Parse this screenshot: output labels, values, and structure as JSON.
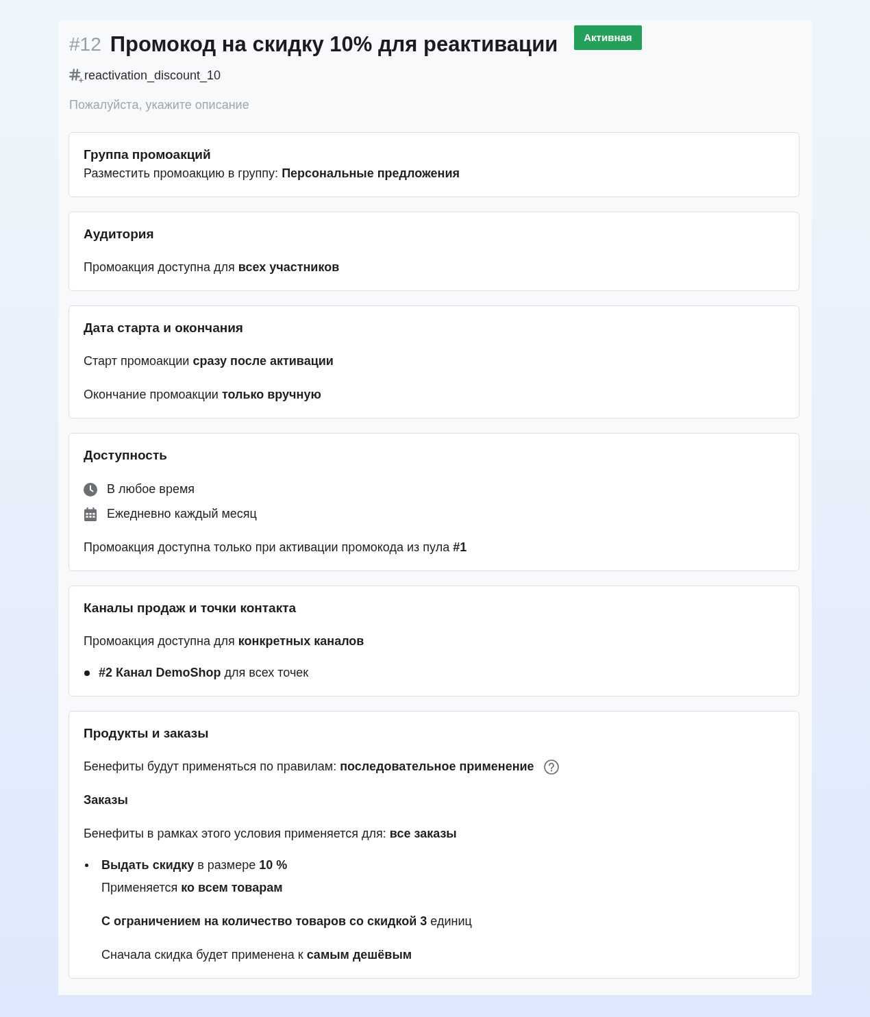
{
  "header": {
    "number": "#12",
    "title": "Промокод на скидку 10% для реактивации",
    "status": "Активная"
  },
  "tag": "reactivation_discount_10",
  "description": {
    "placeholder": "Пожалуйста, укажите описание"
  },
  "sections": [
    {
      "title": "Группа промоакций",
      "subtitle": "Разместить промоакцию в группу: **Персональные предложения**"
    },
    {
      "title": "Аудитория",
      "items": [
        {
          "kind": "text",
          "text": "Промоакция доступна для **всех участников**"
        }
      ]
    },
    {
      "title": "Дата старта и окончания",
      "items": [
        {
          "kind": "text",
          "text": "Старт промоакции **сразу после активации**"
        },
        {
          "kind": "text",
          "text": "Окончание промоакции **только вручную**"
        }
      ]
    },
    {
      "title": "Доступность",
      "items": [
        {
          "kind": "schedule",
          "entries": [
            {
              "kind": "time",
              "text": "В любое время"
            },
            {
              "kind": "days",
              "text": "Ежедневно каждый месяц"
            }
          ]
        },
        {
          "kind": "text",
          "text": "Промоакция доступна только при активации промокода из пула **#1**"
        }
      ]
    },
    {
      "title": "Каналы продаж и точки контакта",
      "items": [
        {
          "kind": "text",
          "text": "Промоакция доступна для **конкретных каналов**"
        },
        {
          "kind": "channel",
          "text": "**#2 Канал DemoShop** для всех точек"
        }
      ]
    },
    {
      "title": "Продукты и заказы",
      "items": [
        {
          "kind": "rule",
          "text": "Бенефиты будут применяться по правилам: **последовательное применение**"
        }
      ],
      "subsection": {
        "title": "Заказы",
        "items": [
          {
            "kind": "text",
            "text": "Бенефиты в рамках этого условия применяется для: **все заказы**"
          },
          {
            "kind": "benefit",
            "text": "**Выдать скидку** в размере **10 %**",
            "details": [
              "Применяется **ко всем товарам**",
              "**С ограничением на количество товаров со скидкой 3** единиц",
              "Сначала скидка будет применена к **самым дешёвым**"
            ]
          }
        ]
      }
    }
  ]
}
